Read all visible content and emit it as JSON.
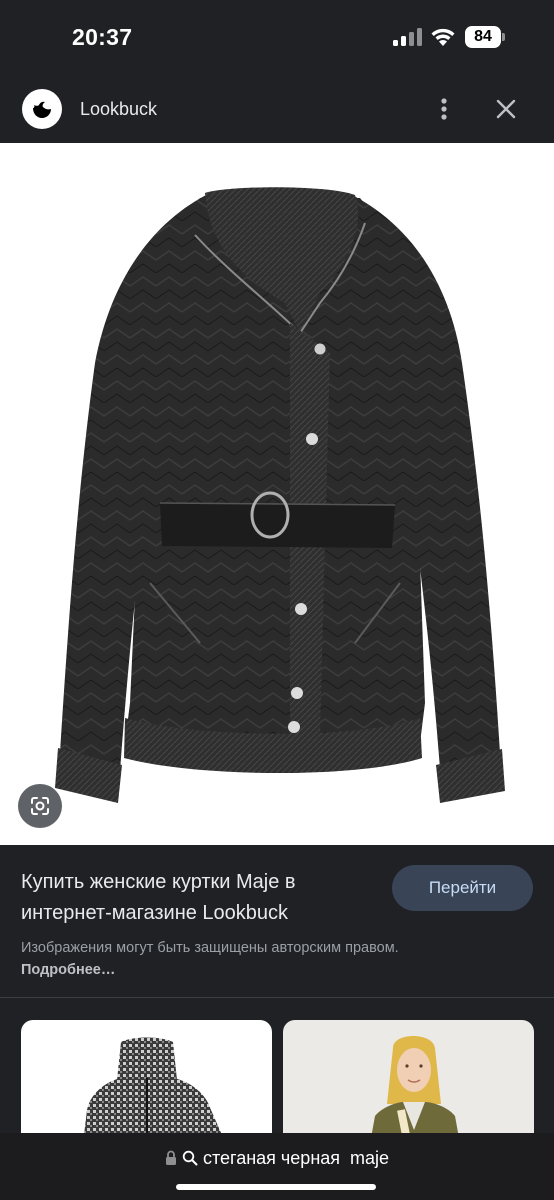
{
  "status_bar": {
    "time": "20:37",
    "battery": "84",
    "icons": [
      "signal-icon",
      "wifi-icon",
      "battery-icon"
    ]
  },
  "header": {
    "site_name": "Lookbuck",
    "icons": [
      "site-logo-icon",
      "more-vert-icon",
      "close-icon"
    ]
  },
  "image_viewer": {
    "lens_icon": "google-lens-icon"
  },
  "result": {
    "title": "Купить женские куртки Maje в интернет-магазине Lookbuck",
    "visit_label": "Перейти",
    "copyright_text": "Изображения могут быть защищены авторским правом.",
    "more_link": "Подробнее…"
  },
  "related": {
    "cards": [
      {
        "kind": "tweed-jacket-thumbnail"
      },
      {
        "kind": "girl-in-olive-jacket-thumbnail"
      }
    ]
  },
  "browser": {
    "url_text": "стеганая черная  maje",
    "icons": [
      "lock-icon",
      "search-icon"
    ]
  },
  "colors": {
    "background": "#202124",
    "button": "#394457",
    "button_text": "#c8dcf5",
    "secondary_text": "#9aa0a6"
  }
}
